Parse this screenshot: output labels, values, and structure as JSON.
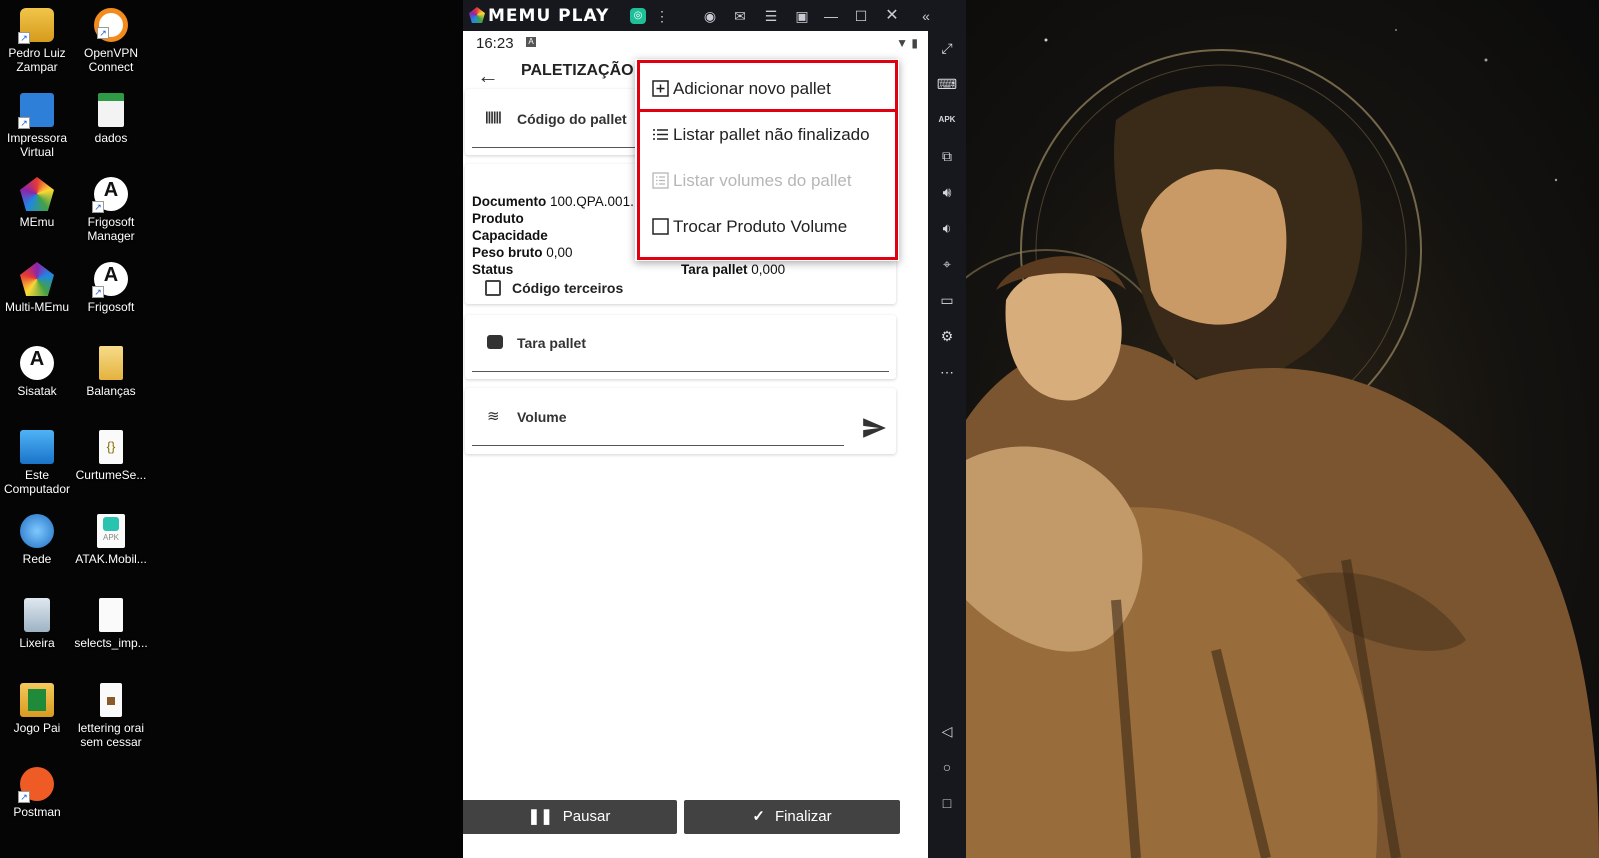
{
  "desktop": {
    "icons": [
      {
        "label": "Pedro Luiz Zampar",
        "icon": "user-folder-icon"
      },
      {
        "label": "OpenVPN Connect",
        "icon": "openvpn-icon"
      },
      {
        "label": "Impressora Virtual",
        "icon": "printer-icon"
      },
      {
        "label": "dados",
        "icon": "spreadsheet-icon"
      },
      {
        "label": "MEmu",
        "icon": "memu-icon"
      },
      {
        "label": "Frigosoft Manager",
        "icon": "atak-icon"
      },
      {
        "label": "Multi-MEmu",
        "icon": "multi-memu-icon"
      },
      {
        "label": "Frigosoft",
        "icon": "atak-icon"
      },
      {
        "label": "Sisatak",
        "icon": "atak-icon"
      },
      {
        "label": "Balanças",
        "icon": "folder-icon"
      },
      {
        "label": "Este Computador",
        "icon": "computer-icon"
      },
      {
        "label": "CurtumeSe...",
        "icon": "json-file-icon"
      },
      {
        "label": "Rede",
        "icon": "network-icon"
      },
      {
        "label": "ATAK.Mobil...",
        "icon": "apk-file-icon"
      },
      {
        "label": "Lixeira",
        "icon": "recycle-bin-icon"
      },
      {
        "label": "selects_imp...",
        "icon": "text-file-icon"
      },
      {
        "label": "Jogo Pai",
        "icon": "folder-icon"
      },
      {
        "label": "lettering orai sem cessar",
        "icon": "image-file-icon"
      },
      {
        "label": "Postman",
        "icon": "postman-icon"
      }
    ]
  },
  "emulator": {
    "brand": "MEMU PLAY",
    "accent": "#e10010"
  },
  "android": {
    "status": {
      "time": "16:23"
    },
    "appbar": {
      "title": "PALETIZAÇÃO I"
    },
    "fields": {
      "pallet_code_label": "Código do pallet",
      "tara_label": "Tara pallet",
      "volume_label": "Volume"
    },
    "info": {
      "documento_label": "Documento",
      "documento_value": "100.QPA.001.",
      "produto_label": "Produto",
      "capacidade_label": "Capacidade",
      "peso_bruto_label": "Peso bruto",
      "peso_bruto_value": "0,00",
      "status_label": "Status",
      "tara_pallet_label": "Tara pallet",
      "tara_pallet_value": "0,000",
      "codigo_terceiros_label": "Código terceiros"
    },
    "buttons": {
      "pause": "Pausar",
      "finish": "Finalizar"
    },
    "menu": {
      "items": [
        {
          "label": "Adicionar novo pallet",
          "enabled": true
        },
        {
          "label": "Listar pallet não finalizado",
          "enabled": true
        },
        {
          "label": "Listar volumes do pallet",
          "enabled": false
        },
        {
          "label": "Trocar Produto Volume",
          "enabled": true
        }
      ]
    }
  }
}
